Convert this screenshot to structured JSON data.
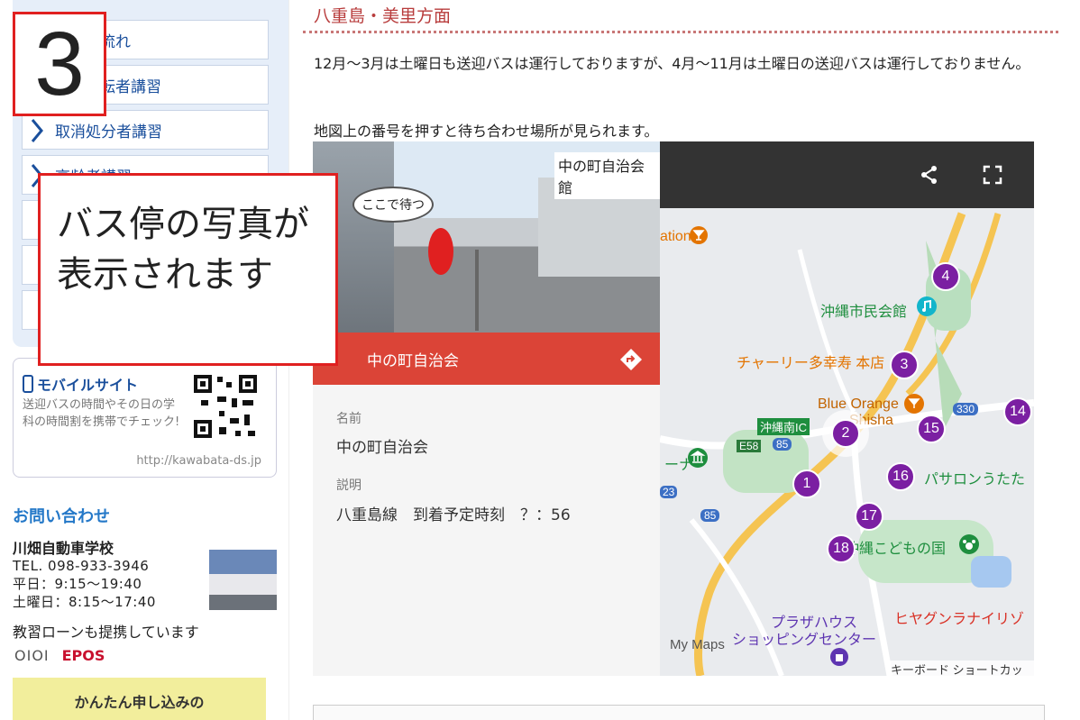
{
  "sidebar": {
    "nav": [
      {
        "label": "流れ"
      },
      {
        "label": "転者講習"
      },
      {
        "label": "取消処分者講習"
      },
      {
        "label": "高齢者講習"
      }
    ],
    "mobile": {
      "title": "モバイルサイト",
      "text": "送迎バスの時間やその日の学科の時間割を携帯でチェック!",
      "url": "http://kawabata-ds.jp"
    },
    "contact": {
      "heading": "お問い合わせ",
      "school": "川畑自動車学校",
      "tel": "TEL. 098-933-3946",
      "weekday": "平日：9:15〜19:40",
      "saturday": "土曜日：8:15〜17:40",
      "loan": "教習ローンも提携しています",
      "logo1": "OIOI",
      "logo2": "EPOS",
      "apply": "かんたん申し込みの"
    }
  },
  "main": {
    "section_title": "八重島・美里方面",
    "para1": "12月〜3月は土曜日も送迎バスは運行しておりますが、4月〜11月は土曜日の送迎バスは運行しておりません。",
    "para2": "地図上の番号を押すと待ち合わせ場所が見られます。"
  },
  "map": {
    "place_title": "中の町自治会館",
    "bubble": "ここで待つ",
    "header": "中の町自治会",
    "name_label": "名前",
    "name_value": "中の町自治会",
    "desc_label": "説明",
    "desc_value": "八重島線　到着予定時刻　？：56",
    "pois": {
      "civic": "沖縄市民会館",
      "charley": "チャーリー多幸寿 本店",
      "blue": "Blue Orange",
      "shisha": "Shisha",
      "ic": "沖縄南IC",
      "zoo": "沖縄こどもの国",
      "plaza": "プラザハウス",
      "center": "ショッピングセンター",
      "higa": "ヒヤグンラナイリゾ",
      "sari": "パサロンうたた",
      "ation": "ation",
      "ina": "ーナ",
      "mymaps": "My Maps",
      "shortcut": "キーボード ショートカット",
      "e58": "E58",
      "r85": "85",
      "r330": "330",
      "r23": "23"
    },
    "markers": [
      "4",
      "3",
      "14",
      "15",
      "2",
      "16",
      "1",
      "17",
      "18"
    ]
  },
  "overlay": {
    "step": "3",
    "callout_line1": "バス停の写真が",
    "callout_line2": "表示されます"
  }
}
